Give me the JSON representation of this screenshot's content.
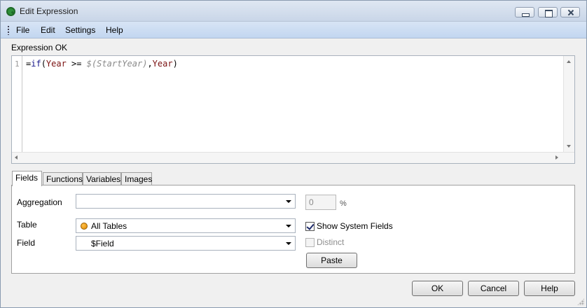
{
  "window": {
    "title": "Edit Expression",
    "icon": "qlikview-app-icon"
  },
  "menu": [
    "File",
    "Edit",
    "Settings",
    "Help"
  ],
  "status_text": "Expression OK",
  "editor": {
    "line_number": "1",
    "code": {
      "eq": "=",
      "fn": "if",
      "open": "(",
      "field1": "Year",
      "op": " >= ",
      "var": "$(StartYear)",
      "comma": ",",
      "field2": "Year",
      "close": ")"
    }
  },
  "tabs": [
    {
      "label": "Fields",
      "active": true
    },
    {
      "label": "Functions",
      "active": false
    },
    {
      "label": "Variables",
      "active": false
    },
    {
      "label": "Images",
      "active": false
    }
  ],
  "fields_panel": {
    "aggregation_label": "Aggregation",
    "aggregation_value": "",
    "table_label": "Table",
    "table_value": "All Tables",
    "field_label": "Field",
    "field_value": "$Field",
    "count_value": "0",
    "count_unit": "%",
    "show_system_fields_label": "Show System Fields",
    "show_system_fields_checked": true,
    "distinct_label": "Distinct",
    "distinct_checked": false,
    "paste_label": "Paste"
  },
  "buttons": {
    "ok": "OK",
    "cancel": "Cancel",
    "help": "Help"
  }
}
